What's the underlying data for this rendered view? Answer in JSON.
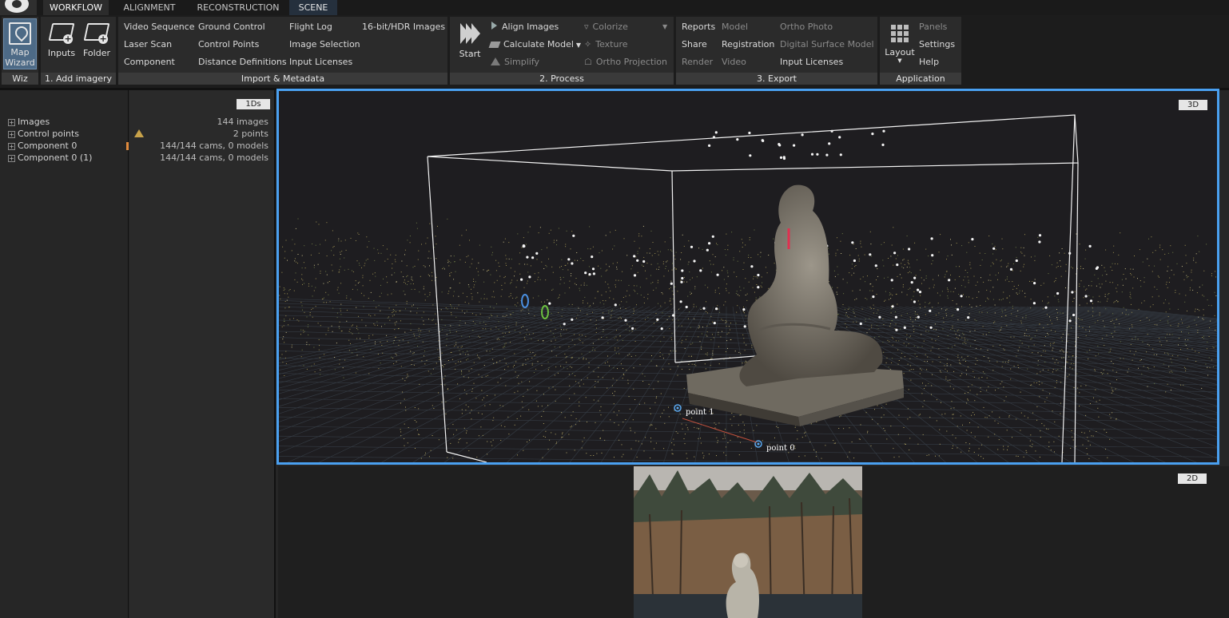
{
  "tabs": [
    {
      "label": "WORKFLOW"
    },
    {
      "label": "ALIGNMENT"
    },
    {
      "label": "RECONSTRUCTION"
    },
    {
      "label": "SCENE"
    }
  ],
  "ribbon": {
    "wiz": {
      "button_label_1": "Map",
      "button_label_2": "Wizard",
      "group_label": "Wiz"
    },
    "add_imagery": {
      "inputs": "Inputs",
      "folder": "Folder",
      "group_label": "1. Add imagery"
    },
    "import": {
      "col1": [
        "Video Sequence",
        "Laser Scan",
        "Component"
      ],
      "col2": [
        "Ground Control",
        "Control Points",
        "Distance Definitions"
      ],
      "col3": [
        "Flight Log",
        "Image Selection",
        "Input Licenses"
      ],
      "col4": [
        "16-bit/HDR Images"
      ],
      "group_label": "Import & Metadata"
    },
    "process": {
      "start": "Start",
      "align": "Align Images",
      "calculate": "Calculate Model",
      "simplify": "Simplify",
      "colorize": "Colorize",
      "texture": "Texture",
      "ortho": "Ortho Projection",
      "group_label": "2. Process"
    },
    "export": {
      "col1": [
        "Reports",
        "Share",
        "Render"
      ],
      "col2": [
        "Model",
        "Registration",
        "Video"
      ],
      "col3": [
        "Ortho Photo",
        "Digital Surface Model",
        "Input Licenses"
      ],
      "group_label": "3. Export"
    },
    "application": {
      "layout": "Layout",
      "items": [
        "Panels",
        "Settings",
        "Help"
      ],
      "group_label": "Application"
    }
  },
  "tree": {
    "items": [
      "Images",
      "Control points",
      "Component 0",
      "Component 0 (1)"
    ]
  },
  "info": {
    "badge": "1Ds",
    "rows": [
      "144 images",
      "2 points",
      "144/144 cams, 0 models",
      "144/144 cams, 0 models"
    ]
  },
  "view3d": {
    "badge": "3D",
    "labels": {
      "point1": "point 1",
      "point0": "point 0"
    }
  },
  "view2d": {
    "badge": "2D"
  },
  "colors": {
    "accent": "#4aa0f0",
    "view_bg": "#1e1d20",
    "warning": "#c8a24a",
    "status_green": "#4caf50"
  }
}
